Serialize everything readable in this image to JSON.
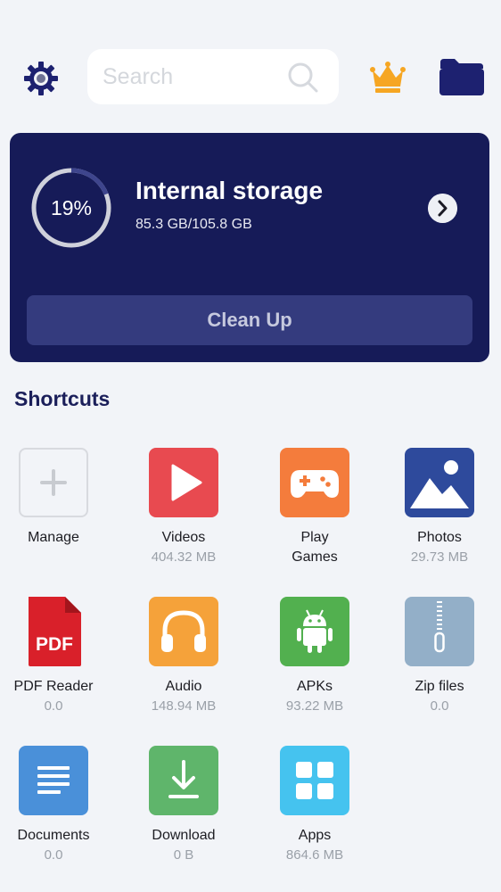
{
  "search": {
    "placeholder": "Search"
  },
  "storage": {
    "percent_label": "19%",
    "used_fraction": 0.19,
    "title": "Internal storage",
    "usage": "85.3 GB/105.8 GB",
    "clean_label": "Clean Up"
  },
  "shortcuts": {
    "title": "Shortcuts",
    "items": [
      {
        "name": "Manage",
        "size": ""
      },
      {
        "name": "Videos",
        "size": "404.32 MB"
      },
      {
        "name": "Play Games",
        "size": ""
      },
      {
        "name": "Photos",
        "size": "29.73 MB"
      },
      {
        "name": "PDF Reader",
        "size": "0.0"
      },
      {
        "name": "Audio",
        "size": "148.94 MB"
      },
      {
        "name": "APKs",
        "size": "93.22 MB"
      },
      {
        "name": "Zip files",
        "size": "0.0"
      },
      {
        "name": "Documents",
        "size": "0.0"
      },
      {
        "name": "Download",
        "size": "0 B"
      },
      {
        "name": "Apps",
        "size": "864.6 MB"
      }
    ]
  },
  "icons": {
    "settings": "gear-icon",
    "search": "search-icon",
    "premium": "crown-icon",
    "files": "folder-icon",
    "arrow": "chevron-right-icon"
  },
  "colors": {
    "card": "#161b58",
    "videos": "#e84a50",
    "games": "#f47c3c",
    "photos": "#2e4a9c",
    "pdf": "#d9202a",
    "audio": "#f5a23a",
    "apks": "#52b04f",
    "zip": "#93afc8",
    "documents": "#4a90d9",
    "download": "#5fb56b",
    "apps": "#45c3ef",
    "crown": "#f6a623"
  }
}
